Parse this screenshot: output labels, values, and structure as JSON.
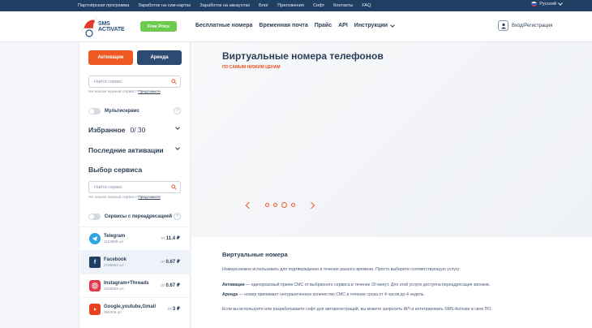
{
  "topbar": {
    "links": [
      "Партнёрская программа",
      "Заработок на сим-картах",
      "Заработок на аккаунтах",
      "Блог",
      "Приложения",
      "Софт",
      "Контакты",
      "FAQ"
    ],
    "language": "Русский"
  },
  "header": {
    "logo_line1": "SMS",
    "logo_line2": "ACTIVATE",
    "free_price": "Free Price",
    "nav": [
      "Бесплатные номера",
      "Временная почта",
      "Прайс",
      "API",
      "Инструкции"
    ],
    "login": "Вход/Регистрация"
  },
  "sidebar": {
    "tab_active": "Активации",
    "tab_rent": "Аренда",
    "search_placeholder": "Найти сервис",
    "hint_text": "Не нашли нужный сервис?",
    "hint_link": "Предложите",
    "multiservice": "Мультисервис",
    "favorites": "Избранное",
    "favorites_count": "0/ 30",
    "recent": "Последние активации",
    "choose": "Выбор сервиса",
    "search2_placeholder": "Найти сервис",
    "hint2_text": "Не нашли нужный сервис?",
    "hint2_link": "Предложите",
    "forwarding": "Сервисы с переадресацией",
    "services": [
      {
        "name": "Telegram",
        "count": "1123889 шт",
        "price_prefix": "от",
        "price": "11.4 ₽",
        "icon": "telegram-icon"
      },
      {
        "name": "Facebook",
        "count": "2785863 шт",
        "price_prefix": "от",
        "price": "0.67 ₽",
        "icon": "facebook-icon"
      },
      {
        "name": "Instagram+Threads",
        "count": "3268589 шт",
        "price_prefix": "от",
        "price": "0.67 ₽",
        "icon": "instagram-icon"
      },
      {
        "name": "Google,youtube,Gmail",
        "count": "388309 шт",
        "price_prefix": "от",
        "price": "3 ₽",
        "icon": "youtube-icon"
      }
    ]
  },
  "main": {
    "title": "Виртуальные номера телефонов",
    "subtitle": "ПО САМЫМ НИЗКИМ ЦЕНАМ",
    "section_title": "Виртуальные номера",
    "para1": "Номера можно использовать для подтверждения в течение разного времени. Просто выберите соответствующую услугу:",
    "para2_bold": "Активации",
    "para2": " — единоразовый прием СМС от выбранного сервиса в течение 20 минут. Для этой услуги доступна переадресация звонков.",
    "para3_bold": "Аренда",
    "para3": " — номер принимает неограниченное количество СМС в течение срока от 4 часов до 4 недель.",
    "para4": "Если вы используете или разрабатываете софт для авторегистраций, вы можете запросить API и интегрировать SMS-Activate в свое ПО."
  },
  "colors": {
    "accent": "#f05a22",
    "navy": "#1f3f63",
    "green": "#6ccb4c"
  }
}
